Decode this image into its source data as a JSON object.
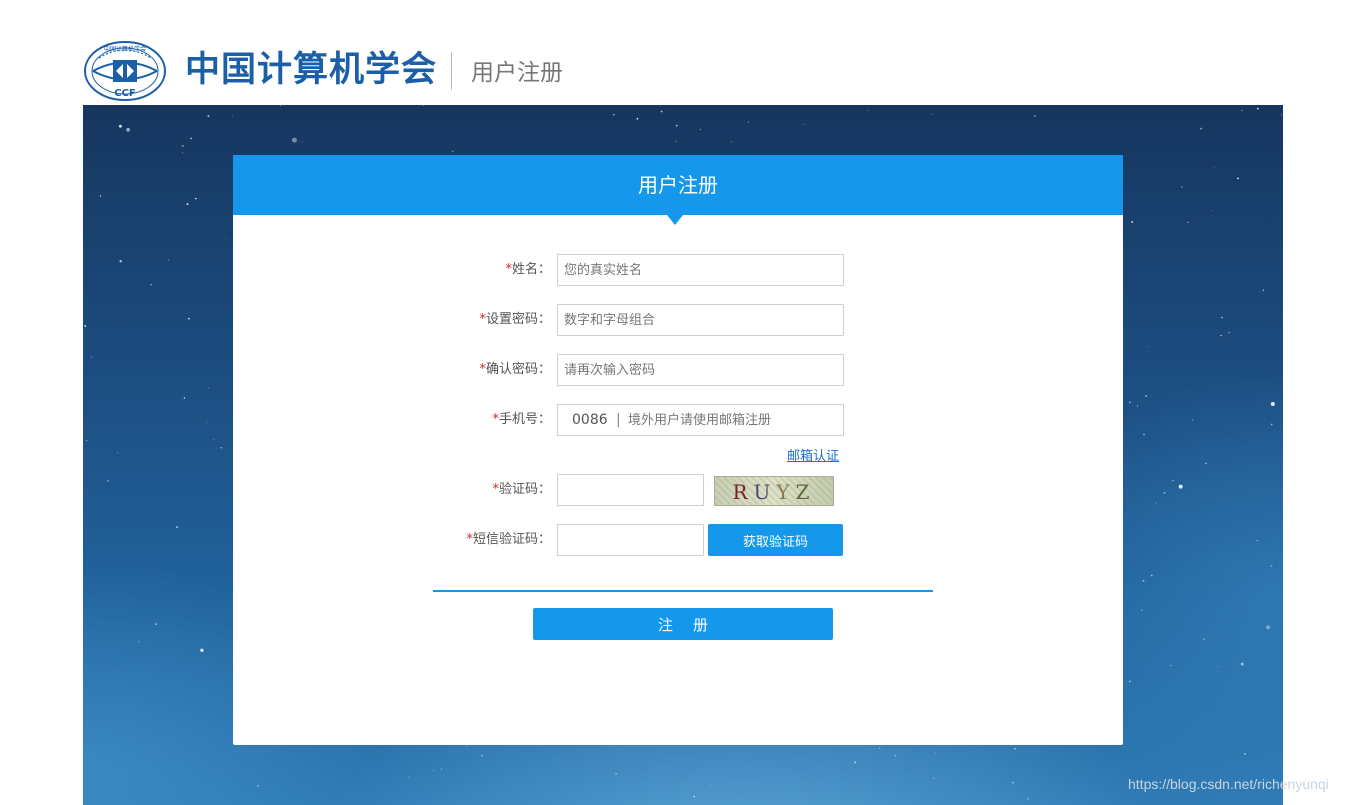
{
  "header": {
    "logo_emblem_text": "CCF",
    "logo_emblem_ring_text": "中国计算机学会",
    "org_name": "中国计算机学会",
    "subtitle": "用户注册"
  },
  "card": {
    "title": "用户注册"
  },
  "form": {
    "required_mark": "*",
    "name": {
      "label": "姓名：",
      "placeholder": "您的真实姓名",
      "value": ""
    },
    "password": {
      "label": "设置密码：",
      "placeholder": "数字和字母组合",
      "value": ""
    },
    "confirm_password": {
      "label": "确认密码：",
      "placeholder": "请再次输入密码",
      "value": ""
    },
    "phone": {
      "label": "手机号：",
      "country_code": "0086",
      "separator": "|",
      "placeholder": "境外用户请使用邮箱注册",
      "value": ""
    },
    "email_link": "邮箱认证",
    "captcha": {
      "label": "验证码：",
      "value": "",
      "image_chars": [
        "R",
        "U",
        "Y",
        "Z"
      ]
    },
    "sms_code": {
      "label": "短信验证码：",
      "value": "",
      "button_label": "获取验证码"
    },
    "submit_label": "注册"
  },
  "watermark": "https://blog.csdn.net/richenyunqi",
  "colors": {
    "accent": "#1597ec",
    "brand": "#1a5fa8",
    "required": "#e02020",
    "link": "#1a6fcf"
  }
}
